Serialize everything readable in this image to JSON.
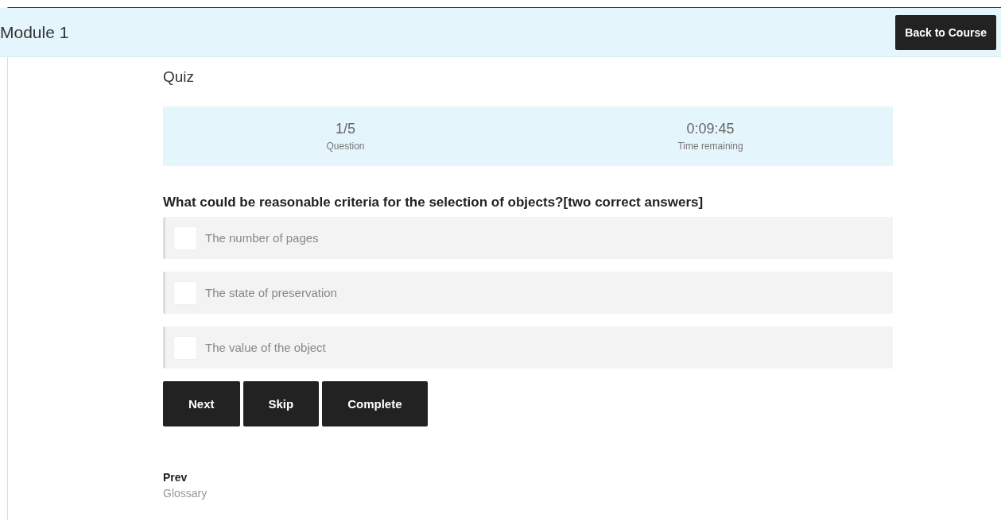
{
  "header": {
    "title": "Module 1",
    "back_button": "Back to Course"
  },
  "quiz": {
    "title": "Quiz",
    "stats": [
      {
        "value": "1/5",
        "label": "Question"
      },
      {
        "value": "0:09:45",
        "label": "Time remaining"
      }
    ],
    "question": "What could be reasonable criteria for the selection of objects?[two correct answers]",
    "options": [
      {
        "label": "The number of pages",
        "checked": false
      },
      {
        "label": "The state of preservation",
        "checked": false
      },
      {
        "label": "The value of the object",
        "checked": false
      }
    ],
    "buttons": [
      "Next",
      "Skip",
      "Complete"
    ]
  },
  "nav": {
    "label": "Prev",
    "link": "Glossary"
  }
}
